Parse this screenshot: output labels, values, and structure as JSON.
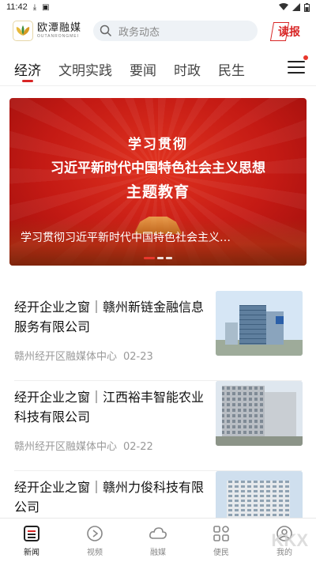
{
  "status_bar": {
    "time": "11:42"
  },
  "header": {
    "logo_cn": "欧潭融媒",
    "logo_en": "OUTANRONGMEI",
    "search_placeholder": "政务动态",
    "dubao_label": "读报"
  },
  "tabs": [
    {
      "label": "经济",
      "active": true
    },
    {
      "label": "文明实践",
      "active": false
    },
    {
      "label": "要闻",
      "active": false
    },
    {
      "label": "时政",
      "active": false
    },
    {
      "label": "民生",
      "active": false
    }
  ],
  "banner": {
    "line1": "学习贯彻",
    "line2": "习近平新时代中国特色社会主义思想",
    "line3": "主题教育",
    "caption": "学习贯彻习近平新时代中国特色社会主义…"
  },
  "news": [
    {
      "title": "经开企业之窗｜赣州新链金融信息服务有限公司",
      "source": "赣州经开区融媒体中心",
      "date": "02-23"
    },
    {
      "title": "经开企业之窗｜江西裕丰智能农业科技有限公司",
      "source": "赣州经开区融媒体中心",
      "date": "02-22"
    },
    {
      "title": "经开企业之窗｜赣州力俊科技有限公司",
      "source": "",
      "date": ""
    }
  ],
  "bottom_nav": [
    {
      "label": "新闻",
      "icon": "news-icon",
      "active": true
    },
    {
      "label": "视频",
      "icon": "video-icon",
      "active": false
    },
    {
      "label": "融媒",
      "icon": "cloud-icon",
      "active": false
    },
    {
      "label": "便民",
      "icon": "grid-icon",
      "active": false
    },
    {
      "label": "我的",
      "icon": "profile-icon",
      "active": false
    }
  ],
  "watermark": "KKX",
  "colors": {
    "accent": "#d82525",
    "banner": "#c41a14"
  }
}
